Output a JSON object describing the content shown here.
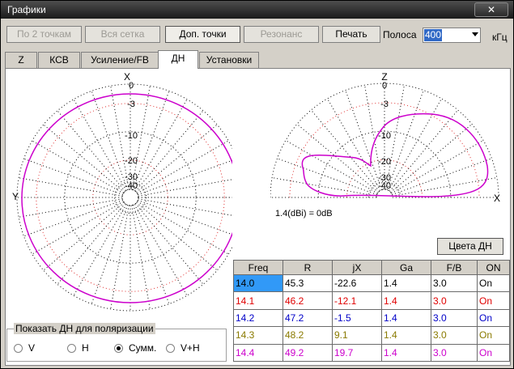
{
  "window": {
    "title": "Графики",
    "close_glyph": "✕"
  },
  "toolbar": {
    "btn_two_points": "По 2 точкам",
    "btn_all_grid": "Вся сетка",
    "btn_extra_points": "Доп. точки",
    "btn_resonance": "Резонанс",
    "btn_print": "Печать",
    "band_label": "Полоса",
    "band_value": "400",
    "band_unit": "кГц"
  },
  "tabs": [
    "Z",
    "КСВ",
    "Усиление/FB",
    "ДН",
    "Установки"
  ],
  "selected_tab": "ДН",
  "plots": {
    "azimuth": {
      "top_label": "X",
      "left_label": "Y",
      "rings": [
        "0",
        "-3",
        "-10",
        "-20",
        "-30",
        "-40"
      ]
    },
    "elevation": {
      "top_label": "Z",
      "right_label": "X",
      "rings": [
        "0",
        "-3",
        "-10",
        "-20",
        "-30",
        "-40"
      ],
      "ref_text": "1.4(dBi) = 0dB"
    }
  },
  "colors_button": "Цвета ДН",
  "colors": {
    "accent": "#cc00cc"
  },
  "table": {
    "headers": [
      "Freq",
      "R",
      "jX",
      "Ga",
      "F/B",
      "ON"
    ],
    "rows": [
      {
        "cells": [
          "14.0",
          "45.3",
          "-22.6",
          "1.4",
          "3.0",
          "On"
        ],
        "color": "#000000"
      },
      {
        "cells": [
          "14.1",
          "46.2",
          "-12.1",
          "1.4",
          "3.0",
          "On"
        ],
        "color": "#e00000"
      },
      {
        "cells": [
          "14.2",
          "47.2",
          "-1.5",
          "1.4",
          "3.0",
          "On"
        ],
        "color": "#0000c8"
      },
      {
        "cells": [
          "14.3",
          "48.2",
          "9.1",
          "1.4",
          "3.0",
          "On"
        ],
        "color": "#8a7a00"
      },
      {
        "cells": [
          "14.4",
          "49.2",
          "19.7",
          "1.4",
          "3.0",
          "On"
        ],
        "color": "#cc00cc"
      }
    ]
  },
  "polarization": {
    "title": "Показать ДН для поляризации",
    "options": [
      "V",
      "H",
      "Сумм.",
      "V+H"
    ],
    "selected": "Сумм."
  }
}
